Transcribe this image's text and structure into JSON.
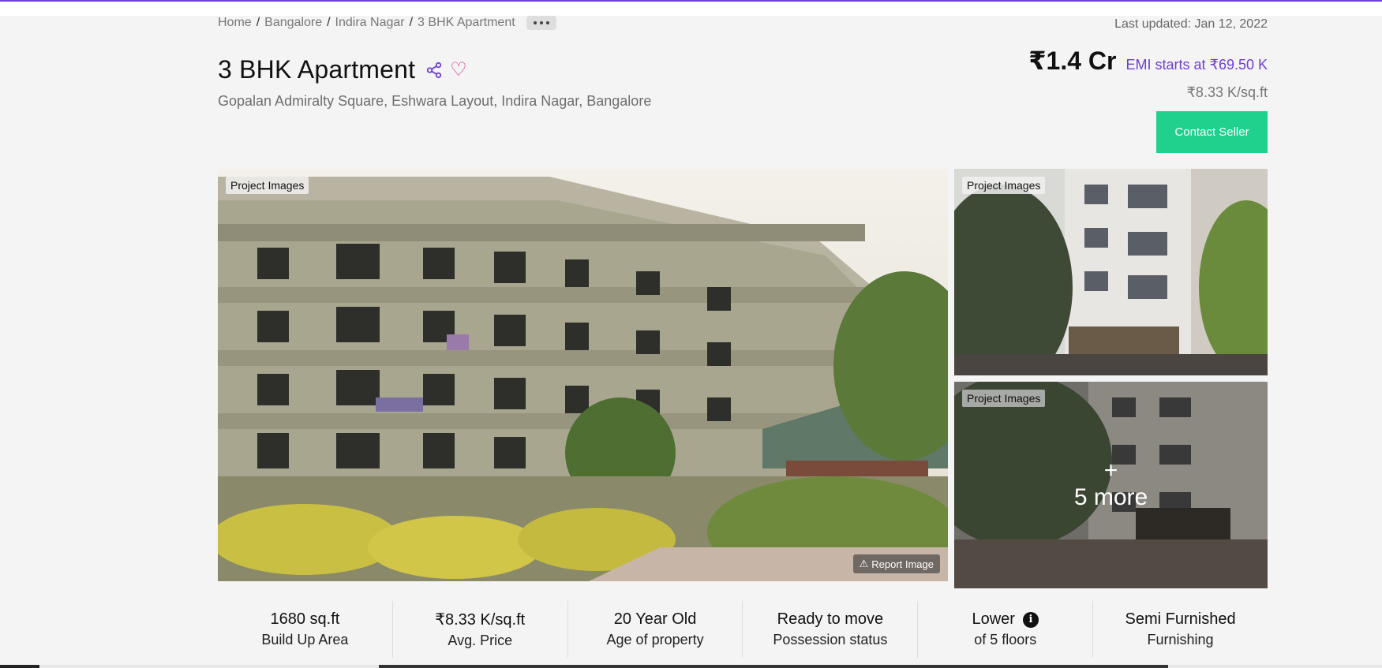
{
  "breadcrumb": {
    "items": [
      "Home",
      "Bangalore",
      "Indira Nagar",
      "3 BHK Apartment"
    ],
    "separator": "/"
  },
  "last_updated": "Last updated: Jan 12, 2022",
  "listing": {
    "title": "3 BHK Apartment",
    "address": "Gopalan Admiralty Square, Eshwara Layout, Indira Nagar, Bangalore",
    "price": "₹1.4 Cr",
    "emi": "EMI starts at ₹69.50 K",
    "price_per_sqft": "₹8.33 K/sq.ft"
  },
  "contact_button": "Contact Seller",
  "icons": {
    "share": "share-icon",
    "favorite": "heart-icon",
    "more": "more-dots-icon",
    "report": "warning-icon",
    "info": "info-icon"
  },
  "gallery": {
    "image_label": "Project Images",
    "report_label": "Report Image",
    "more_plus": "+",
    "more_count": "5 more"
  },
  "stats": [
    {
      "value": "1680 sq.ft",
      "label": "Build Up Area"
    },
    {
      "value": "₹8.33 K/sq.ft",
      "label": "Avg. Price"
    },
    {
      "value": "20 Year Old",
      "label": "Age of property"
    },
    {
      "value": "Ready to move",
      "label": "Possession status"
    },
    {
      "value": "Lower",
      "label": "of 5 floors"
    },
    {
      "value": "Semi Furnished",
      "label": "Furnishing"
    }
  ],
  "colors": {
    "accent": "#6d3fd3",
    "cta": "#1fd18d",
    "favorite": "#d6338f",
    "background": "#f4f4f4"
  }
}
